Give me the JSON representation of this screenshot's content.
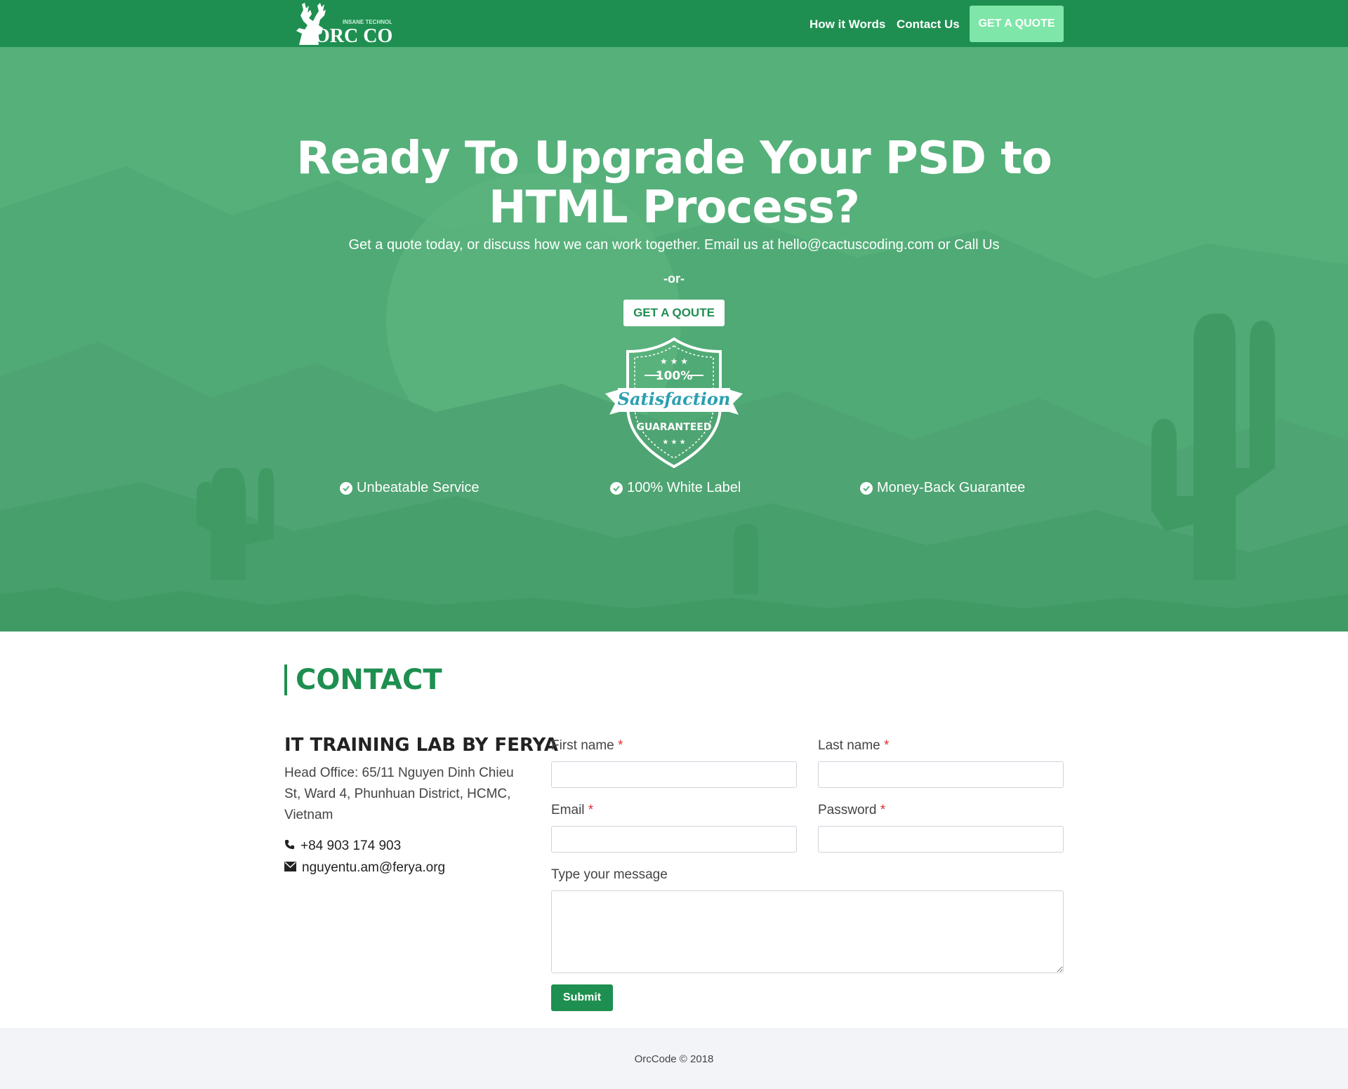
{
  "brand": {
    "logo_name": "ORC CODE",
    "logo_tagline": "INSANE TECHNOLOGY",
    "logo_icon": "deer-head-icon"
  },
  "nav": {
    "items": [
      "How it Words",
      "Contact Us"
    ],
    "cta": "GET A QUOTE"
  },
  "hero": {
    "title": "Ready To Upgrade Your PSD to HTML Process?",
    "subtitle": "Get a quote today, or discuss how we can work together. Email us at hello@cactuscoding.com or Call Us",
    "or_text": "-or-",
    "button": "GET A QOUTE",
    "badge": {
      "top": "100%",
      "ribbon": "Satisfaction",
      "bottom": "GUARANTEED"
    },
    "features": [
      "Unbeatable Service",
      "100% White Label",
      "Money-Back Guarantee"
    ]
  },
  "contact": {
    "heading": "CONTACT",
    "company": "IT TRAINING LAB BY FERYA",
    "address": "Head Office: 65/11 Nguyen Dinh Chieu St, Ward 4, Phunhuan District, HCMC, Vietnam",
    "phone": "+84 903 174 903",
    "email": "nguyentu.am@ferya.org"
  },
  "form": {
    "first_name": "First name",
    "last_name": "Last name",
    "email": "Email",
    "password": "Password",
    "message": "Type your message",
    "required_mark": "*",
    "submit": "Submit"
  },
  "footer": {
    "text": "OrcCode © 2018"
  },
  "colors": {
    "primary": "#1e8f50",
    "hero_bg": "#55b07a",
    "cta_light": "#7ee6a8",
    "required": "#e0302f"
  }
}
